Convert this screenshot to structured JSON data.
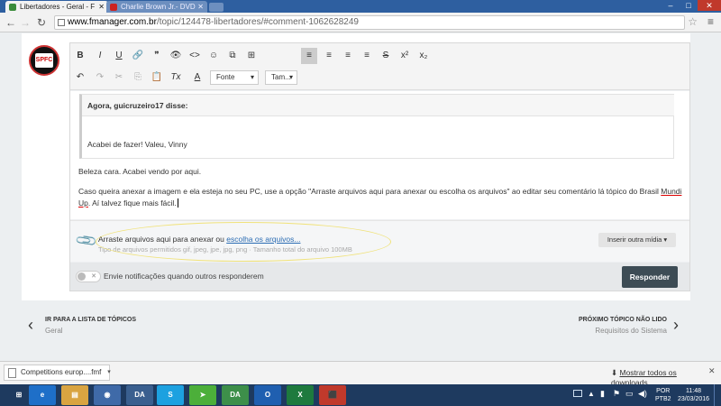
{
  "browser": {
    "tabs": [
      {
        "label": "Libertadores - Geral - F",
        "icon_color": "#3a8b3a"
      },
      {
        "label": "Charlie Brown Jr.- DVD",
        "icon_color": "#cc2222"
      }
    ],
    "url_host": "www.fmanager.com.br",
    "url_path": "/topic/124478-libertadores/#comment-1062628249",
    "window_controls": [
      "–",
      "□",
      "✕"
    ]
  },
  "editor": {
    "toolbar_row1": [
      "B",
      "I",
      "U",
      "🔗",
      "❞",
      "👁",
      "<>",
      "☺",
      "⧉",
      "⊞",
      "≡",
      "≡",
      "≡",
      "≡",
      "S",
      "x²",
      "x₂"
    ],
    "toolbar_row2": [
      "↶",
      "↷",
      "✂",
      "⎘",
      "📋",
      "Tx",
      "A"
    ],
    "font_dropdown": "Fonte",
    "size_dropdown": "Tam...",
    "quote_header": "Agora, guicruzeiro17 disse:",
    "quote_text": "Acabei de fazer! Valeu, Vinny",
    "paragraph1": "Beleza cara. Acabei vendo por aqui.",
    "paragraph2_line1_a": "Caso queira anexar a imagem e ela esteja no seu PC, use a opção \"Arraste arquivos aqui para anexar ou escolha os arquivos\" ao editar seu comentário lá tópico do Brasil ",
    "paragraph2_line1_b": "Mundi",
    "paragraph2_line2_a": "Up",
    "paragraph2_line2_b": ". Aí talvez fique mais fácil."
  },
  "attach": {
    "drop_text": "Arraste arquivos aqui para anexar ou ",
    "choose_link": "escolha os arquivos...",
    "allowed_types": "Tipo de arquivos permitidos gif, jpeg, jpe, jpg, png · Tamanho total do arquivo 100MB",
    "insert_button": "Inserir outra mídia ▾"
  },
  "footer": {
    "notify_label": "Envie notificações quando outros responderem",
    "reply_button": "Responder"
  },
  "nav": {
    "prev_title": "IR PARA A LISTA DE TÓPICOS",
    "prev_sub": "Geral",
    "next_title": "PRÓXIMO TÓPICO NÃO LIDO",
    "next_sub": "Requisitos do Sistema"
  },
  "downloads": {
    "file": "Competitions europ....fmf",
    "show_all": "Mostrar todos os downloads...",
    "close": "✕"
  },
  "taskbar": {
    "apps": [
      {
        "name": "start",
        "label": "⊞",
        "color": "#1e3a5f"
      },
      {
        "name": "ie",
        "label": "e",
        "color": "#1e6fc8"
      },
      {
        "name": "explorer",
        "label": "▤",
        "color": "#d9a441"
      },
      {
        "name": "chrome",
        "label": "◉",
        "color": "#3f6aa8"
      },
      {
        "name": "da1",
        "label": "DA",
        "color": "#3a5f8f"
      },
      {
        "name": "skype",
        "label": "S",
        "color": "#1da1e0"
      },
      {
        "name": "arrow",
        "label": "➤",
        "color": "#4caf3a"
      },
      {
        "name": "da2",
        "label": "DA",
        "color": "#3d8f4a"
      },
      {
        "name": "outlook",
        "label": "O",
        "color": "#1f5fb0"
      },
      {
        "name": "excel",
        "label": "X",
        "color": "#1e7a3e"
      },
      {
        "name": "pdf",
        "label": "⬛",
        "color": "#c0392b"
      }
    ],
    "lang": "POR\nPTB2",
    "time": "11:48",
    "date": "23/03/2016"
  }
}
